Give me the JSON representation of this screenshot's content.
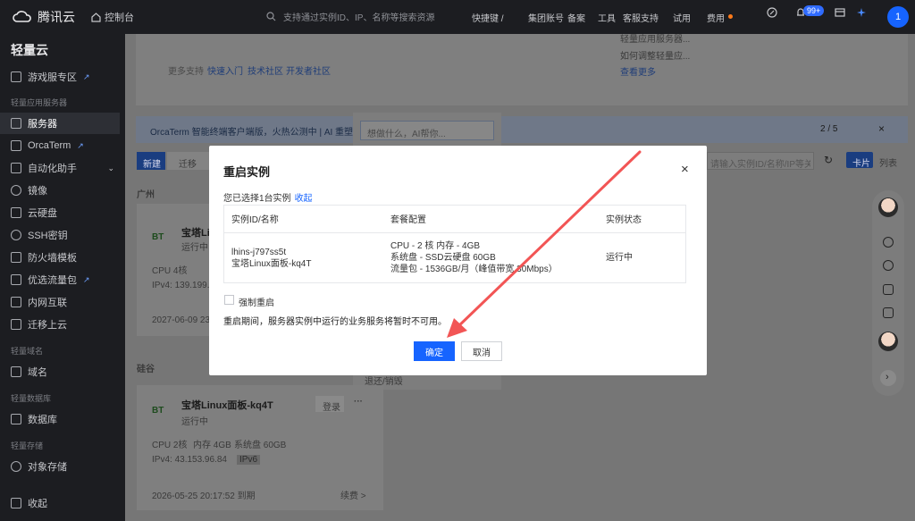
{
  "topbar": {
    "brand": "腾讯云",
    "console": "控制台",
    "search_placeholder": "支持通过实例ID、IP、名称等搜索资源",
    "quick_entry": "快捷键 /",
    "links": [
      "集团账号",
      "备案",
      "工具",
      "客服支持",
      "试用",
      "费用"
    ],
    "badge": "99+",
    "user_initial": "1"
  },
  "sidebar": {
    "title": "轻量云",
    "items": [
      {
        "label": "游戏服专区",
        "external": true
      },
      {
        "label": "服务器",
        "active": true
      },
      {
        "label": "OrcaTerm",
        "external": true
      },
      {
        "label": "自动化助手"
      },
      {
        "label": "镜像"
      },
      {
        "label": "云硬盘"
      },
      {
        "label": "SSH密钥"
      },
      {
        "label": "防火墙模板"
      },
      {
        "label": "优选流量包",
        "external": true
      },
      {
        "label": "内网互联"
      },
      {
        "label": "迁移上云"
      },
      {
        "label": "域名"
      },
      {
        "label": "数据库"
      },
      {
        "label": "对象存储"
      }
    ],
    "groups": [
      "轻量应用服务器",
      "轻量域名",
      "轻量数据库",
      "轻量存储"
    ],
    "collapse": "收起"
  },
  "background": {
    "support_label": "更多支持",
    "support_links": [
      "快速入门",
      "技术社区",
      "开发者社区"
    ],
    "right_links": [
      "轻量应用服务器...",
      "如何调整轻量应...",
      "查看更多"
    ],
    "notice": "OrcaTerm 智能终端客户端版，火热公测中 | AI 重塑终端...",
    "ai_placeholder": "想做什么，AI帮你...",
    "pager": "2 / 5",
    "new_button": "新建",
    "migrate_button": "迁移",
    "filter_placeholder": "请输入实例ID/名称/IP等关键词或标签回车键分隔",
    "view_card": "卡片",
    "view_list": "列表",
    "region1": "广州",
    "region2": "硅谷",
    "card1": {
      "name": "宝塔Li...",
      "status": "运行中",
      "spec": "CPU 4核",
      "ipv4": "IPv4: 139.199.21...",
      "expire": "2027-06-09 23..."
    },
    "card2": {
      "name": "宝塔Linux面板-kq4T",
      "status": "运行中",
      "cpu": "CPU 2核",
      "mem": "内存 4GB",
      "disk": "系统盘 60GB",
      "ipv4": "IPv4: 43.153.96.84",
      "ipv6": "IPv6",
      "login": "登录",
      "expire": "2026-05-25 20:17:52 到期",
      "renew": "续费 >"
    },
    "menu_tail": "退还/销毁"
  },
  "modal": {
    "title": "重启实例",
    "selected_text": "您已选择1台实例",
    "collapse_link": "收起",
    "columns": [
      "实例ID/名称",
      "套餐配置",
      "实例状态"
    ],
    "row": {
      "id": "lhins-j797ss5t",
      "name": "宝塔Linux面板-kq4T",
      "config": [
        "CPU - 2 核 内存 - 4GB",
        "系统盘 - SSD云硬盘 60GB",
        "流量包 - 1536GB/月（峰值带宽 30Mbps）"
      ],
      "status": "运行中"
    },
    "force_label": "强制重启",
    "warning": "重启期间，服务器实例中运行的业务服务将暂时不可用。",
    "ok": "确定",
    "cancel": "取消"
  },
  "colors": {
    "primary": "#1664ff",
    "running": "#0abf5b",
    "arrow": "#f25555"
  }
}
